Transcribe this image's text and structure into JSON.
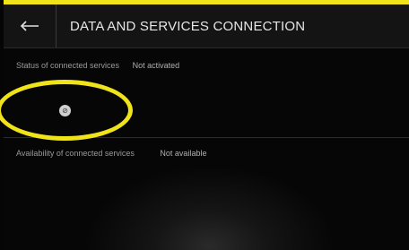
{
  "header": {
    "title": "DATA AND SERVICES CONNECTION",
    "back_icon": "back-arrow-icon"
  },
  "status": {
    "label": "Status of connected services",
    "value": "Not activated"
  },
  "toggle": {
    "icon": "toggle-icon",
    "glyph": "⊘"
  },
  "availability": {
    "label": "Availability of connected services",
    "value": "Not available"
  },
  "colors": {
    "highlight": "#f0e31a",
    "background": "#050505"
  }
}
